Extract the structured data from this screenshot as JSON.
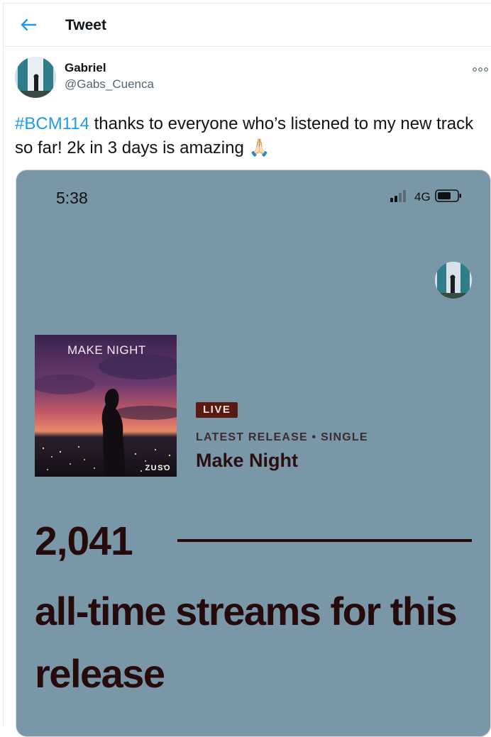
{
  "header": {
    "title": "Tweet"
  },
  "tweet": {
    "author": {
      "display_name": "Gabriel",
      "handle": "@Gabs_Cuenca"
    },
    "hashtag": "#BCM114",
    "body": " thanks to everyone who’s listened to my new track so far! 2k in 3 days is amazing ",
    "emoji": "🙏🏻"
  },
  "media": {
    "status_bar": {
      "time": "5:38",
      "network": "4G"
    },
    "album": {
      "cover_title": "MAKE NIGHT",
      "cover_artist": "ZUSO"
    },
    "badge": "LIVE",
    "release_meta": "LATEST RELEASE • SINGLE",
    "release_title": "Make Night",
    "stream_count": "2,041",
    "stream_caption": "all-time streams for this release"
  },
  "colors": {
    "accent": "#1d9bf0",
    "media_background": "#7a97a8",
    "badge_background": "#5a1a14",
    "stat_text": "#260b0c"
  }
}
